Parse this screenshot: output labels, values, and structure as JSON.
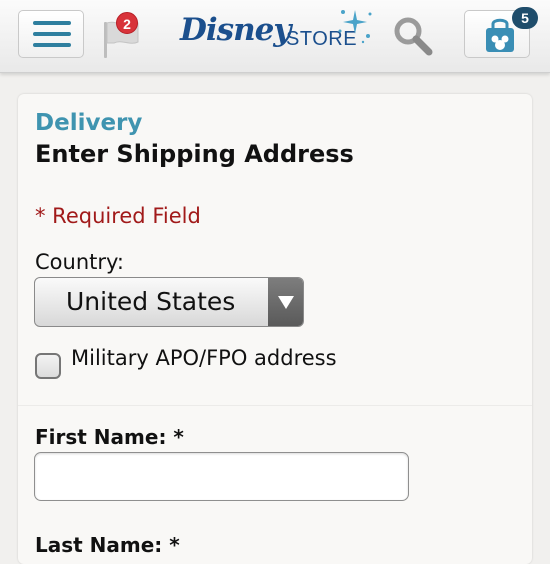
{
  "header": {
    "menu_icon": "hamburger-menu-icon",
    "notifications": {
      "icon": "flag-icon",
      "count": "2",
      "badge_color": "#d8333a"
    },
    "logo": {
      "wordmark": "Disney",
      "suffix": "STORE",
      "brand_color": "#1b4f8d"
    },
    "search_icon": "magnifier-icon",
    "bag": {
      "icon": "shopping-bag-icon",
      "count": "5",
      "badge_color": "#1f4d6b"
    }
  },
  "form": {
    "section_label": "Delivery",
    "title": "Enter Shipping Address",
    "required_note": "* Required Field",
    "country": {
      "label": "Country:",
      "selected": "United States"
    },
    "military": {
      "label": "Military APO/FPO address",
      "checked": false
    },
    "first_name": {
      "label": "First Name: *",
      "value": ""
    },
    "last_name": {
      "label": "Last Name: *"
    }
  },
  "colors": {
    "accent": "#3f94b0",
    "required": "#a11a1a",
    "menu_icon": "#2f7f9f"
  }
}
